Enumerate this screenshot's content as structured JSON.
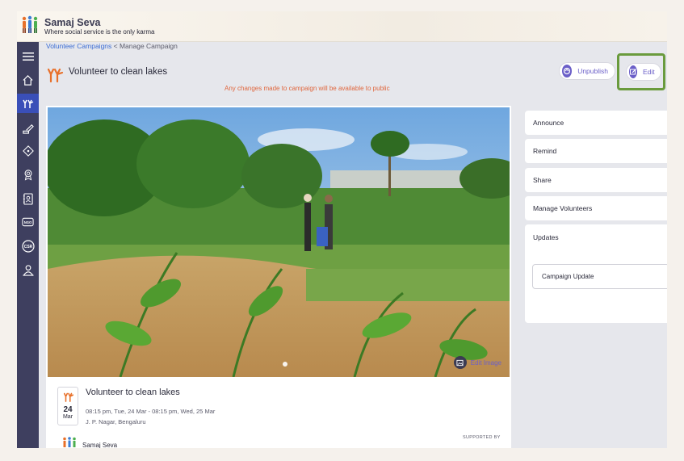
{
  "brand": {
    "name": "Samaj Seva",
    "tagline": "Where social service is the only karma"
  },
  "breadcrumb": {
    "parent": "Volunteer Campaigns",
    "separator": " < ",
    "current": "Manage Campaign"
  },
  "page": {
    "title": "Volunteer to clean lakes",
    "notice": "Any changes made to campaign will be available to public"
  },
  "header_actions": {
    "unpublish_label": "Unpublish",
    "edit_label": "Edit"
  },
  "sidebar": {
    "items": [
      {
        "icon": "menu-icon"
      },
      {
        "icon": "home-icon"
      },
      {
        "icon": "volunteer-hands-icon",
        "active": true
      },
      {
        "icon": "pen-edit-icon"
      },
      {
        "icon": "tag-icon"
      },
      {
        "icon": "award-ribbon-icon"
      },
      {
        "icon": "contacts-book-icon"
      },
      {
        "icon": "ngo-icon"
      },
      {
        "icon": "csr-icon"
      },
      {
        "icon": "people-icon"
      }
    ]
  },
  "campaign": {
    "image_badge": "Edit Image",
    "title": "Volunteer to clean lakes",
    "date_day": "24",
    "date_month": "Mar",
    "time": "08:15 pm, Tue, 24 Mar - 08:15 pm, Wed, 25 Mar",
    "location": "J. P. Nagar, Bengaluru",
    "supported_by": "SUPPORTED BY",
    "organizer": "Samaj Seva"
  },
  "actions": {
    "items": [
      "Announce",
      "Remind",
      "Share",
      "Manage Volunteers"
    ],
    "updates_label": "Updates",
    "update_field_label": "Campaign Update"
  },
  "colors": {
    "accent": "#6b5fc8",
    "sidebar": "#3e3f5f",
    "sidebar_active": "#3a4fb8",
    "notice": "#e0673e",
    "highlight": "#6a9b3d"
  }
}
